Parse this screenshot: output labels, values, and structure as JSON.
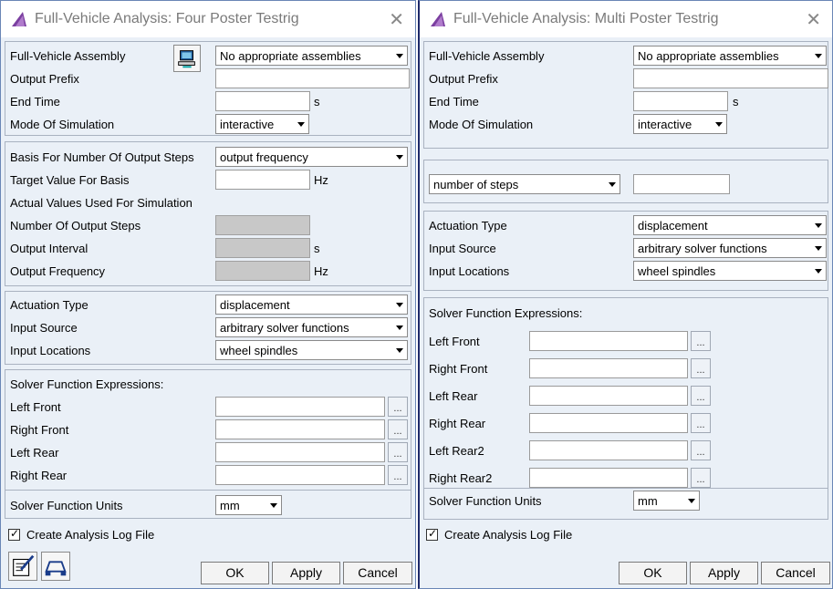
{
  "left": {
    "title": "Full-Vehicle Analysis: Four Poster Testrig",
    "assembly_label": "Full-Vehicle Assembly",
    "assembly_value": "No appropriate assemblies",
    "output_prefix_label": "Output Prefix",
    "end_time_label": "End Time",
    "end_time_unit": "s",
    "mode_label": "Mode Of Simulation",
    "mode_value": "interactive",
    "basis_label": "Basis For Number Of Output Steps",
    "basis_value": "output frequency",
    "target_label": "Target Value For Basis",
    "target_unit": "Hz",
    "actual_label": "Actual Values Used For Simulation",
    "num_steps_label": "Number Of Output Steps",
    "interval_label": "Output Interval",
    "interval_unit": "s",
    "frequency_label": "Output Frequency",
    "frequency_unit": "Hz",
    "actuation_label": "Actuation Type",
    "actuation_value": "displacement",
    "input_source_label": "Input Source",
    "input_source_value": "arbitrary solver functions",
    "input_locations_label": "Input Locations",
    "input_locations_value": "wheel spindles",
    "solver_expr_label": "Solver Function Expressions:",
    "left_front_label": "Left Front",
    "right_front_label": "Right Front",
    "left_rear_label": "Left Rear",
    "right_rear_label": "Right Rear",
    "units_label": "Solver Function Units",
    "units_value": "mm",
    "log_label": "Create Analysis Log File",
    "ok": "OK",
    "apply": "Apply",
    "cancel": "Cancel",
    "dots": "..."
  },
  "right": {
    "title": "Full-Vehicle Analysis: Multi Poster Testrig",
    "assembly_label": "Full-Vehicle Assembly",
    "assembly_value": "No appropriate assemblies",
    "output_prefix_label": "Output Prefix",
    "end_time_label": "End Time",
    "end_time_unit": "s",
    "mode_label": "Mode Of Simulation",
    "mode_value": "interactive",
    "steps_value": "number of steps",
    "actuation_label": "Actuation Type",
    "actuation_value": "displacement",
    "input_source_label": "Input Source",
    "input_source_value": "arbitrary solver functions",
    "input_locations_label": "Input Locations",
    "input_locations_value": "wheel spindles",
    "solver_expr_label": "Solver Function Expressions:",
    "left_front_label": "Left Front",
    "right_front_label": "Right Front",
    "left_rear_label": "Left Rear",
    "right_rear_label": "Right Rear",
    "left_rear2_label": "Left Rear2",
    "right_rear2_label": "Right Rear2",
    "units_label": "Solver Function Units",
    "units_value": "mm",
    "log_label": "Create Analysis Log File",
    "ok": "OK",
    "apply": "Apply",
    "cancel": "Cancel",
    "dots": "..."
  },
  "colors": {
    "dialog_bg": "#eaf0f7",
    "disabled_field": "#c8c8c8",
    "title_text": "#7a7a7a",
    "app_icon": "#7b3fa0"
  },
  "icons": {
    "app": "adams-car-icon",
    "close": "close-icon",
    "browse_assembly": "computer-icon",
    "edit_tool": "edit-notepad-icon",
    "vehicle_tool": "vehicle-icon"
  }
}
